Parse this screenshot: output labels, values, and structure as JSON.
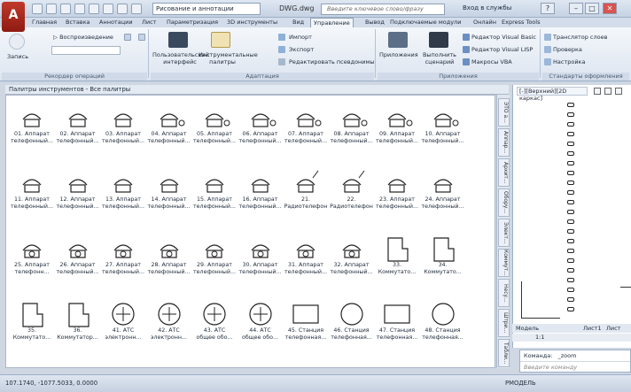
{
  "app": {
    "logo_letter": "A",
    "doc_title": "DWG.dwg",
    "workspace": "Рисование и аннотации",
    "search_placeholder": "Введите ключевое слово/фразу",
    "signin": "Вход в службы",
    "help": "?"
  },
  "tabs": [
    "Главная",
    "Вставка",
    "Аннотации",
    "Лист",
    "Параметризация",
    "3D инструменты",
    "Вид",
    "Управление",
    "Вывод",
    "Подключаемые модули",
    "Онлайн",
    "Express Tools"
  ],
  "active_tab": "Управление",
  "ribbon": {
    "record_label": "Запись",
    "play_label": "Воспроизведение",
    "panel_macros": "Рекордер операций",
    "cui_label": "Пользовательский интерфейс",
    "toolpal_label": "Инструментальные палитры",
    "import_label": "Импорт",
    "export_label": "Экспорт",
    "aliases_label": "Редактировать псевдонимы",
    "panel_adapt": "Адаптация",
    "apps_label": "Приложения",
    "runscript_label": "Выполнить сценарий",
    "vba_editor": "Редактор Visual Basic",
    "lisp_editor": "Редактор Visual LISP",
    "vba_macros": "Макросы VBA",
    "panel_apps": "Приложения",
    "layer_translator": "Транслятор слоев",
    "check_label": "Проверка",
    "config_label": "Настройка",
    "panel_standards": "Стандарты оформления"
  },
  "palette": {
    "title": "Палитры инструментов - Все палитры",
    "side_tabs": [
      "ЭТО а...",
      "Аппар...",
      "Архит...",
      "Обору...",
      "Элект...",
      "Коммут...",
      "Несу...",
      "Штри...",
      "Табли..."
    ],
    "tools": [
      {
        "l1": "01. Аппарат",
        "l2": "телефонный..."
      },
      {
        "l1": "02. Аппарат",
        "l2": "телефонный..."
      },
      {
        "l1": "03. Аппарат",
        "l2": "телефонный..."
      },
      {
        "l1": "04. Аппарат",
        "l2": "телефонный..."
      },
      {
        "l1": "05. Аппарат",
        "l2": "телефонный..."
      },
      {
        "l1": "06. Аппарат",
        "l2": "телефонный..."
      },
      {
        "l1": "07. Аппарат",
        "l2": "телефонный..."
      },
      {
        "l1": "08. Аппарат",
        "l2": "телефонный..."
      },
      {
        "l1": "09. Аппарат",
        "l2": "телефонный..."
      },
      {
        "l1": "10. Аппарат",
        "l2": "телефонный..."
      },
      {
        "l1": "11. Аппарат",
        "l2": "телефонный..."
      },
      {
        "l1": "12. Аппарат",
        "l2": "телефонный..."
      },
      {
        "l1": "13. Аппарат",
        "l2": "телефонный..."
      },
      {
        "l1": "14. Аппарат",
        "l2": "телефонный..."
      },
      {
        "l1": "15. Аппарат",
        "l2": "телефонный..."
      },
      {
        "l1": "16. Аппарат",
        "l2": "телефонный..."
      },
      {
        "l1": "21.",
        "l2": "Радиотелефон"
      },
      {
        "l1": "22.",
        "l2": "Радиотелефон"
      },
      {
        "l1": "23. Аппарат",
        "l2": "телефонный..."
      },
      {
        "l1": "24. Аппарат",
        "l2": "телефонный..."
      },
      {
        "l1": "25. Аппарат",
        "l2": "телефонн..."
      },
      {
        "l1": "26. Аппарат",
        "l2": "телефонный..."
      },
      {
        "l1": "27. Аппарат",
        "l2": "телефонный..."
      },
      {
        "l1": "28. Аппарат",
        "l2": "телефонный..."
      },
      {
        "l1": "29. Аппарат",
        "l2": "телефонный..."
      },
      {
        "l1": "30. Аппарат",
        "l2": "телефонный..."
      },
      {
        "l1": "31. Аппарат",
        "l2": "телефонный..."
      },
      {
        "l1": "32. Аппарат",
        "l2": "телефонный..."
      },
      {
        "l1": "33.",
        "l2": "Коммутато..."
      },
      {
        "l1": "34.",
        "l2": "Коммутато..."
      },
      {
        "l1": "35.",
        "l2": "Коммутато..."
      },
      {
        "l1": "36.",
        "l2": "Коммутатор..."
      },
      {
        "l1": "41. АТС",
        "l2": "электронн..."
      },
      {
        "l1": "42. АТС",
        "l2": "электронн..."
      },
      {
        "l1": "43. АТС",
        "l2": "общее обо..."
      },
      {
        "l1": "44. АТС",
        "l2": "общее обо..."
      },
      {
        "l1": "45. Станция",
        "l2": "телефонная..."
      },
      {
        "l1": "46. Станция",
        "l2": "телефонная..."
      },
      {
        "l1": "47. Станция",
        "l2": "телефонная..."
      },
      {
        "l1": "48. Станция",
        "l2": "телефонная..."
      }
    ]
  },
  "viewport": {
    "label": "[-][Верхний][2D каркас]",
    "model_tab": "Модель",
    "layout1": "Лист1",
    "layout2": "Лист"
  },
  "cmd": {
    "label": "Команда:",
    "line1": "_zoom",
    "placeholder": "Введите команду"
  },
  "status": {
    "coords": "107.1740, -1077.5033, 0.0000",
    "model": "РМОДЕЛЬ",
    "scale": "1:1"
  }
}
